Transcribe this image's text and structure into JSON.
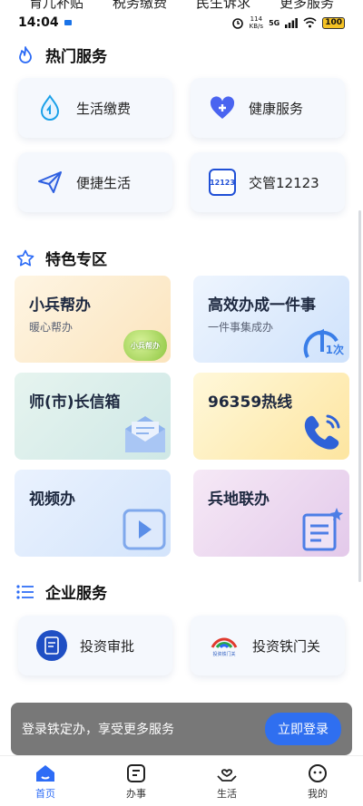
{
  "top_quick": [
    "育儿补贴",
    "税务缴费",
    "民生诉求",
    "更多服务"
  ],
  "status": {
    "time": "14:04",
    "speed_top": "114",
    "speed_unit": "KB/s",
    "net": "5G",
    "battery": "100"
  },
  "sections": {
    "hot": {
      "title": "热门服务"
    },
    "special": {
      "title": "特色专区"
    },
    "enterprise": {
      "title": "企业服务"
    }
  },
  "hot_services": [
    {
      "label": "生活缴费",
      "icon": "water-drop-icon"
    },
    {
      "label": "健康服务",
      "icon": "heart-plus-icon"
    },
    {
      "label": "便捷生活",
      "icon": "paper-plane-icon"
    },
    {
      "label": "交管12123",
      "icon": "traffic-12123-icon",
      "icon_text": "12123"
    }
  ],
  "tiles": [
    {
      "title": "小兵帮办",
      "subtitle": "暖心帮办",
      "bg": "#fdf0d6",
      "deco_text": "小兵帮办"
    },
    {
      "title": "高效办成一件事",
      "subtitle": "一件事集成办",
      "bg": "#e4effc",
      "deco_text": "1次"
    },
    {
      "title": "师(市)长信箱",
      "subtitle": "",
      "bg": "#dcefe9"
    },
    {
      "title": "96359热线",
      "subtitle": "",
      "bg": "#fdf2c8"
    },
    {
      "title": "视频办",
      "subtitle": "",
      "bg": "#e4eefc"
    },
    {
      "title": "兵地联办",
      "subtitle": "",
      "bg": "#f0def3"
    }
  ],
  "enterprise_services": [
    {
      "label": "投资审批",
      "icon": "investment-approval-icon"
    },
    {
      "label": "投资铁门关",
      "icon": "tiemenguan-logo-icon",
      "icon_text": "投资铁门关"
    }
  ],
  "login": {
    "text": "登录铁定办，享受更多服务",
    "button": "立即登录"
  },
  "nav": [
    {
      "label": "首页",
      "active": true
    },
    {
      "label": "办事",
      "active": false
    },
    {
      "label": "生活",
      "active": false
    },
    {
      "label": "我的",
      "active": false
    }
  ],
  "colors": {
    "accent": "#2d6cf6",
    "banner_btn": "#2f6ff0"
  }
}
